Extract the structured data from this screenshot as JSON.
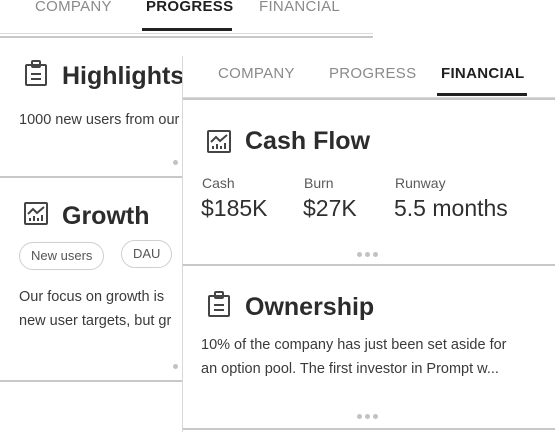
{
  "back_panel": {
    "tabs": [
      {
        "label": "COMPANY",
        "active": false
      },
      {
        "label": "PROGRESS",
        "active": true
      },
      {
        "label": "FINANCIAL",
        "active": false
      }
    ],
    "highlights": {
      "title": "Highlights",
      "icon": "clipboard-icon",
      "text": "1000 new users from our"
    },
    "growth": {
      "title": "Growth",
      "icon": "chart-icon",
      "chips": [
        "New users",
        "DAU"
      ],
      "text_line1": "Our focus on growth is",
      "text_line2": "new user targets, but gr"
    }
  },
  "front_panel": {
    "tabs": [
      {
        "label": "COMPANY",
        "active": false
      },
      {
        "label": "PROGRESS",
        "active": false
      },
      {
        "label": "FINANCIAL",
        "active": true
      }
    ],
    "cash_flow": {
      "title": "Cash Flow",
      "icon": "chart-icon",
      "stats": [
        {
          "label": "Cash",
          "value": "$185K"
        },
        {
          "label": "Burn",
          "value": "$27K"
        },
        {
          "label": "Runway",
          "value": "5.5 months"
        }
      ]
    },
    "ownership": {
      "title": "Ownership",
      "icon": "clipboard-icon",
      "text_line1": "10% of the company has just been set aside for",
      "text_line2": "an option pool. The first investor in Prompt w..."
    }
  },
  "colors": {
    "accent": "#222222",
    "inactive_tab": "#8a8a8a",
    "divider": "#c8c8c8",
    "icon_stroke": "#444444"
  }
}
